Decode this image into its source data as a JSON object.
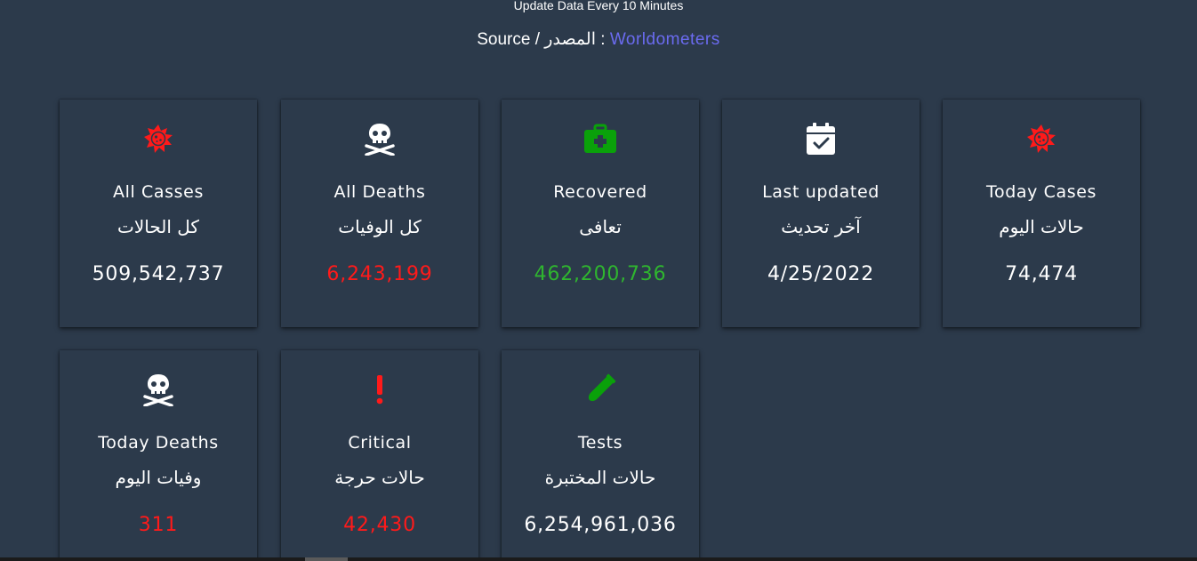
{
  "header": {
    "update_note": "Update Data Every 10 Minutes",
    "source_label": "Source / المصدر",
    "source_sep": " : ",
    "source_link": "Worldometers"
  },
  "colors": {
    "red": "#ff1a1a",
    "green": "#2fb52f",
    "icon_green": "#0aa10a",
    "white": "#ffffff",
    "link": "#6b6bf0",
    "background": "#2c3a4b"
  },
  "cards": {
    "all_cases": {
      "en": "All Casses",
      "ar": "كل الحالات",
      "value": "509,542,737",
      "icon": "virus-icon"
    },
    "all_deaths": {
      "en": "All Deaths",
      "ar": "كل الوفيات",
      "value": "6,243,199",
      "icon": "skull-crossbones-icon"
    },
    "recovered": {
      "en": "Recovered",
      "ar": "تعافى",
      "value": "462,200,736",
      "icon": "medkit-icon"
    },
    "last_updated": {
      "en": "Last updated",
      "ar": "آخر تحديث",
      "value": "4/25/2022",
      "icon": "calendar-check-icon"
    },
    "today_cases": {
      "en": "Today Cases",
      "ar": "حالات اليوم",
      "value": "74,474",
      "icon": "virus-icon"
    },
    "today_deaths": {
      "en": "Today Deaths",
      "ar": "وفيات اليوم",
      "value": "311",
      "icon": "skull-crossbones-icon"
    },
    "critical": {
      "en": "Critical",
      "ar": "حالات حرجة",
      "value": "42,430",
      "icon": "exclamation-icon"
    },
    "tests": {
      "en": "Tests",
      "ar": "حالات المختبرة",
      "value": "6,254,961,036",
      "icon": "test-tube-icon"
    }
  }
}
